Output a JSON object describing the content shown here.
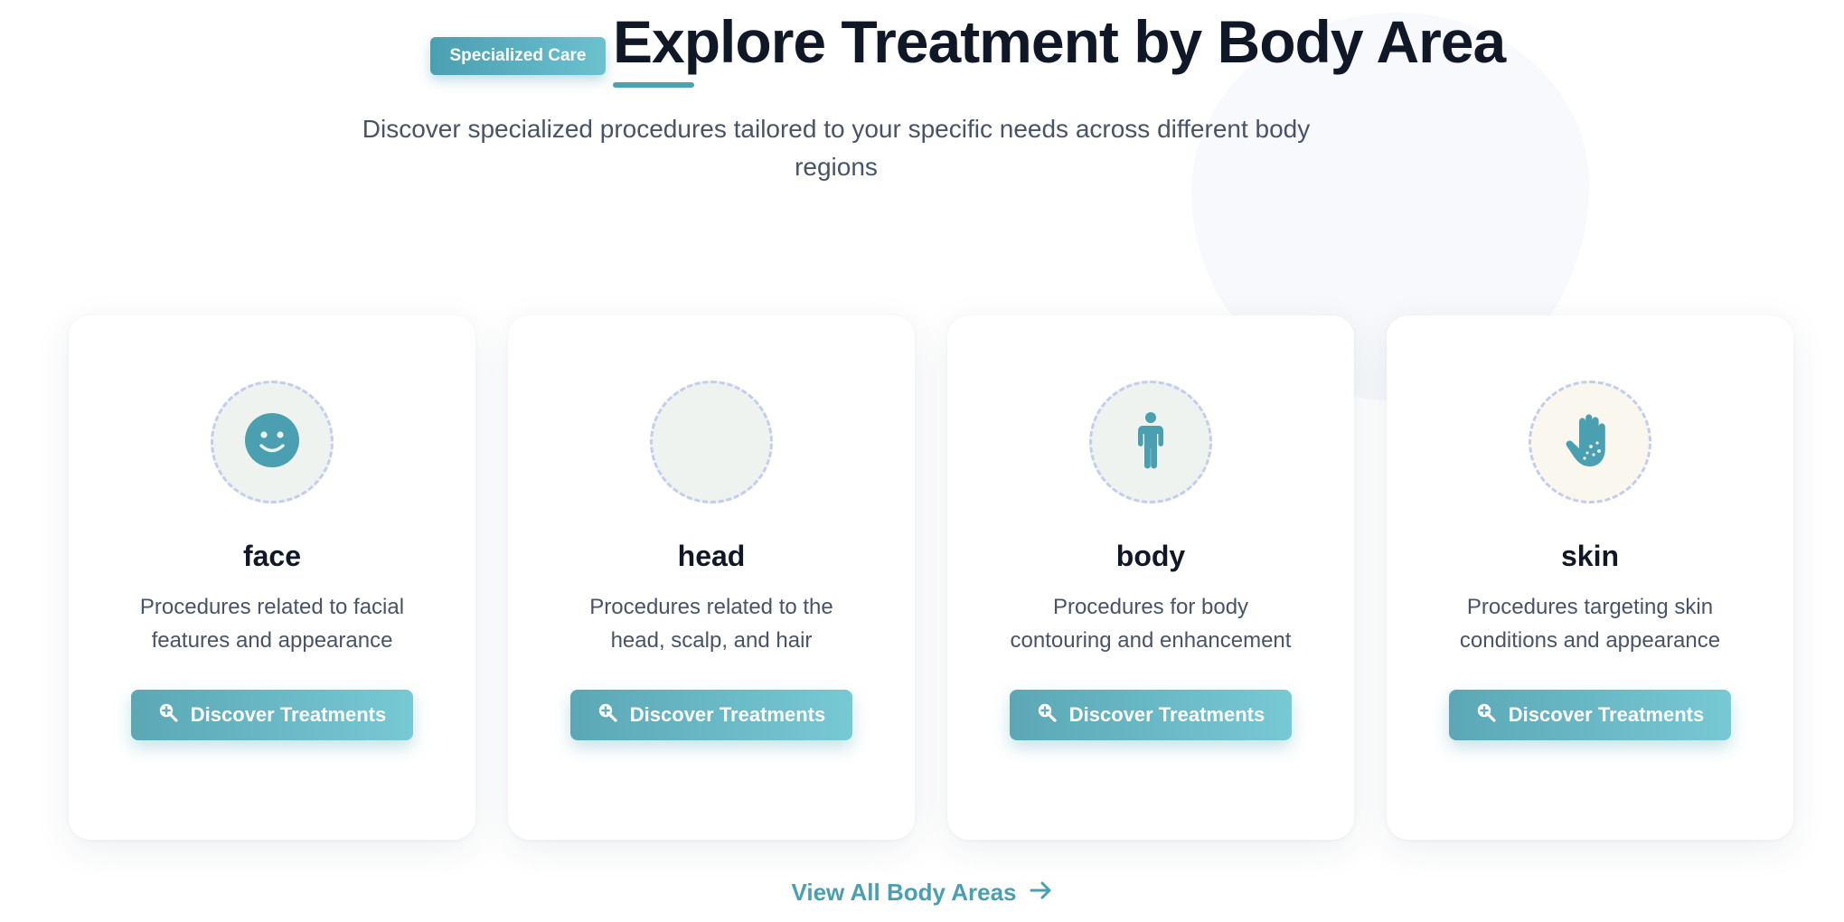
{
  "header": {
    "badge": "Specialized Care",
    "title": "Explore Treatment by Body Area",
    "subtitle": "Discover specialized procedures tailored to your specific needs across different body regions"
  },
  "cards": [
    {
      "title": "face",
      "description": "Procedures related to facial features and appearance",
      "button_label": "Discover Treatments",
      "icon": "smile-icon"
    },
    {
      "title": "head",
      "description": "Procedures related to the head, scalp, and hair",
      "button_label": "Discover Treatments",
      "icon": ""
    },
    {
      "title": "body",
      "description": "Procedures for body contouring and enhancement",
      "button_label": "Discover Treatments",
      "icon": "person-icon"
    },
    {
      "title": "skin",
      "description": "Procedures targeting skin conditions and appearance",
      "button_label": "Discover Treatments",
      "icon": "hand-dots-icon"
    }
  ],
  "footer": {
    "view_all": "View All Body Areas",
    "view_all_icon": "arrow-right-icon"
  },
  "colors": {
    "accent": "#4a9fb0",
    "button_gradient_start": "#5ba7b6",
    "button_gradient_end": "#77c9d4",
    "heading": "#101828",
    "body_text": "#475467"
  }
}
